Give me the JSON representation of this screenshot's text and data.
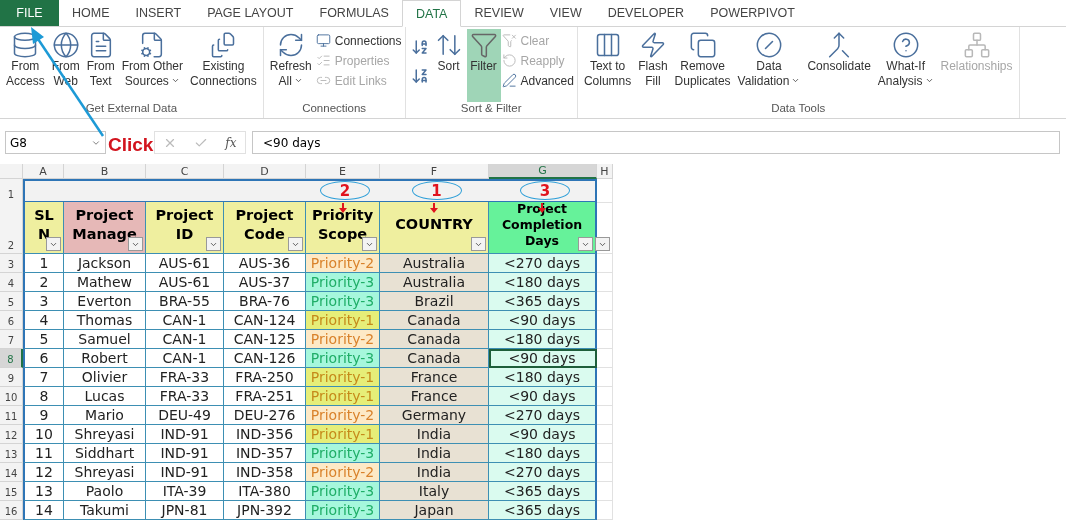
{
  "ribbon_tabs": [
    {
      "label": "FILE",
      "kind": "file",
      "selected": false
    },
    {
      "label": "HOME",
      "kind": "tab",
      "selected": false
    },
    {
      "label": "INSERT",
      "kind": "tab",
      "selected": false
    },
    {
      "label": "PAGE LAYOUT",
      "kind": "tab",
      "selected": false
    },
    {
      "label": "FORMULAS",
      "kind": "tab",
      "selected": false
    },
    {
      "label": "DATA",
      "kind": "tab",
      "selected": true
    },
    {
      "label": "REVIEW",
      "kind": "tab",
      "selected": false
    },
    {
      "label": "VIEW",
      "kind": "tab",
      "selected": false
    },
    {
      "label": "DEVELOPER",
      "kind": "tab",
      "selected": false
    },
    {
      "label": "POWERPIVOT",
      "kind": "tab",
      "selected": false
    }
  ],
  "ribbon_groups": [
    {
      "label": "Get External Data",
      "items": [
        {
          "kind": "large",
          "label": "From\nAccess",
          "disabled": false,
          "dropdown": false,
          "selected": false
        },
        {
          "kind": "large",
          "label": "From\nWeb",
          "disabled": false,
          "dropdown": false,
          "selected": false
        },
        {
          "kind": "large",
          "label": "From\nText",
          "disabled": false,
          "dropdown": false,
          "selected": false
        },
        {
          "kind": "large",
          "label": "From Other\nSources",
          "disabled": false,
          "dropdown": true,
          "selected": false
        },
        {
          "kind": "large",
          "label": "Existing\nConnections",
          "disabled": false,
          "dropdown": false,
          "selected": false
        }
      ]
    },
    {
      "label": "Connections",
      "items": [
        {
          "kind": "large",
          "label": "Refresh\nAll",
          "disabled": false,
          "dropdown": true,
          "selected": false
        },
        {
          "kind": "small",
          "label": "Connections",
          "disabled": false
        },
        {
          "kind": "small",
          "label": "Properties",
          "disabled": true
        },
        {
          "kind": "small",
          "label": "Edit Links",
          "disabled": true
        }
      ]
    },
    {
      "label": "Sort & Filter",
      "items": [
        {
          "kind": "sorticons"
        },
        {
          "kind": "large",
          "label": "Sort",
          "disabled": false,
          "dropdown": false,
          "selected": false
        },
        {
          "kind": "large",
          "label": "Filter",
          "disabled": false,
          "dropdown": false,
          "selected": true
        },
        {
          "kind": "small",
          "label": "Clear",
          "disabled": true
        },
        {
          "kind": "small",
          "label": "Reapply",
          "disabled": true
        },
        {
          "kind": "small",
          "label": "Advanced",
          "disabled": false
        }
      ]
    },
    {
      "label": "Data Tools",
      "items": [
        {
          "kind": "large",
          "label": "Text to\nColumns",
          "disabled": false,
          "dropdown": false,
          "selected": false
        },
        {
          "kind": "large",
          "label": "Flash\nFill",
          "disabled": false,
          "dropdown": false,
          "selected": false
        },
        {
          "kind": "large",
          "label": "Remove\nDuplicates",
          "disabled": false,
          "dropdown": false,
          "selected": false
        },
        {
          "kind": "large",
          "label": "Data\nValidation",
          "disabled": false,
          "dropdown": true,
          "selected": false
        },
        {
          "kind": "large",
          "label": "Consolidate",
          "disabled": false,
          "dropdown": false,
          "selected": false
        },
        {
          "kind": "large",
          "label": "What-If\nAnalysis",
          "disabled": false,
          "dropdown": true,
          "selected": false
        },
        {
          "kind": "large",
          "label": "Relationships",
          "disabled": true,
          "dropdown": false,
          "selected": false
        }
      ]
    }
  ],
  "name_box": "G8",
  "function_label": "fx",
  "formula": "<90 days",
  "callout": "Click",
  "columns": [
    {
      "letter": "A",
      "selected": false
    },
    {
      "letter": "B",
      "selected": false
    },
    {
      "letter": "C",
      "selected": false
    },
    {
      "letter": "D",
      "selected": false
    },
    {
      "letter": "E",
      "selected": false
    },
    {
      "letter": "F",
      "selected": false
    },
    {
      "letter": "G",
      "selected": true
    },
    {
      "letter": "H",
      "selected": false
    }
  ],
  "title_row_num": "1",
  "header_row_num": "2",
  "markers": [
    "2",
    "1",
    "3"
  ],
  "headers": [
    {
      "text": "SL N",
      "color": "#efef9f"
    },
    {
      "text": "Project Manage",
      "color": "#e6b8b7"
    },
    {
      "text": "Project ID",
      "color": "#efef9f"
    },
    {
      "text": "Project Code",
      "color": "#efef9f"
    },
    {
      "text": "Priority Scope",
      "color": "#efef9f"
    },
    {
      "text": "COUNTRY",
      "color": "#efef9f"
    },
    {
      "text": "Project Completion Days",
      "color": "#66f29a"
    }
  ],
  "rows": [
    {
      "num": "3",
      "selected": false,
      "cells": [
        "1",
        "Jackson",
        "AUS-61",
        "AUS-36"
      ],
      "priority": {
        "text": "Priority-2",
        "kind": "p2"
      },
      "country": "Australia",
      "days": "<270 days"
    },
    {
      "num": "4",
      "selected": false,
      "cells": [
        "2",
        "Mathew",
        "AUS-61",
        "AUS-37"
      ],
      "priority": {
        "text": "Priority-3",
        "kind": "p3"
      },
      "country": "Australia",
      "days": "<180 days"
    },
    {
      "num": "5",
      "selected": false,
      "cells": [
        "3",
        "Everton",
        "BRA-55",
        "BRA-76"
      ],
      "priority": {
        "text": "Priority-3",
        "kind": "p3"
      },
      "country": "Brazil",
      "days": "<365 days"
    },
    {
      "num": "6",
      "selected": false,
      "cells": [
        "4",
        "Thomas",
        "CAN-1",
        "CAN-124"
      ],
      "priority": {
        "text": "Priority-1",
        "kind": "p1"
      },
      "country": "Canada",
      "days": "<90 days"
    },
    {
      "num": "7",
      "selected": false,
      "cells": [
        "5",
        "Samuel",
        "CAN-1",
        "CAN-125"
      ],
      "priority": {
        "text": "Priority-2",
        "kind": "p2"
      },
      "country": "Canada",
      "days": "<180 days"
    },
    {
      "num": "8",
      "selected": true,
      "cells": [
        "6",
        "Robert",
        "CAN-1",
        "CAN-126"
      ],
      "priority": {
        "text": "Priority-3",
        "kind": "p3"
      },
      "country": "Canada",
      "days": "<90 days"
    },
    {
      "num": "9",
      "selected": false,
      "cells": [
        "7",
        "Olivier",
        "FRA-33",
        "FRA-250"
      ],
      "priority": {
        "text": "Priority-1",
        "kind": "p1"
      },
      "country": "France",
      "days": "<180 days"
    },
    {
      "num": "10",
      "selected": false,
      "cells": [
        "8",
        "Lucas",
        "FRA-33",
        "FRA-251"
      ],
      "priority": {
        "text": "Priority-1",
        "kind": "p1"
      },
      "country": "France",
      "days": "<90 days"
    },
    {
      "num": "11",
      "selected": false,
      "cells": [
        "9",
        "Mario",
        "DEU-49",
        "DEU-276"
      ],
      "priority": {
        "text": "Priority-2",
        "kind": "p2"
      },
      "country": "Germany",
      "days": "<270 days"
    },
    {
      "num": "12",
      "selected": false,
      "cells": [
        "10",
        "Shreyasi",
        "IND-91",
        "IND-356"
      ],
      "priority": {
        "text": "Priority-1",
        "kind": "p1"
      },
      "country": "India",
      "days": "<90 days"
    },
    {
      "num": "13",
      "selected": false,
      "cells": [
        "11",
        "Siddhart",
        "IND-91",
        "IND-357"
      ],
      "priority": {
        "text": "Priority-3",
        "kind": "p3"
      },
      "country": "India",
      "days": "<180 days"
    },
    {
      "num": "14",
      "selected": false,
      "cells": [
        "12",
        "Shreyasi",
        "IND-91",
        "IND-358"
      ],
      "priority": {
        "text": "Priority-2",
        "kind": "p2"
      },
      "country": "India",
      "days": "<270 days"
    },
    {
      "num": "15",
      "selected": false,
      "cells": [
        "13",
        "Paolo",
        "ITA-39",
        "ITA-380"
      ],
      "priority": {
        "text": "Priority-3",
        "kind": "p3"
      },
      "country": "Italy",
      "days": "<365 days"
    },
    {
      "num": "16",
      "selected": false,
      "cells": [
        "14",
        "Takumi",
        "JPN-81",
        "JPN-392"
      ],
      "priority": {
        "text": "Priority-3",
        "kind": "p3"
      },
      "country": "Japan",
      "days": "<365 days"
    }
  ]
}
